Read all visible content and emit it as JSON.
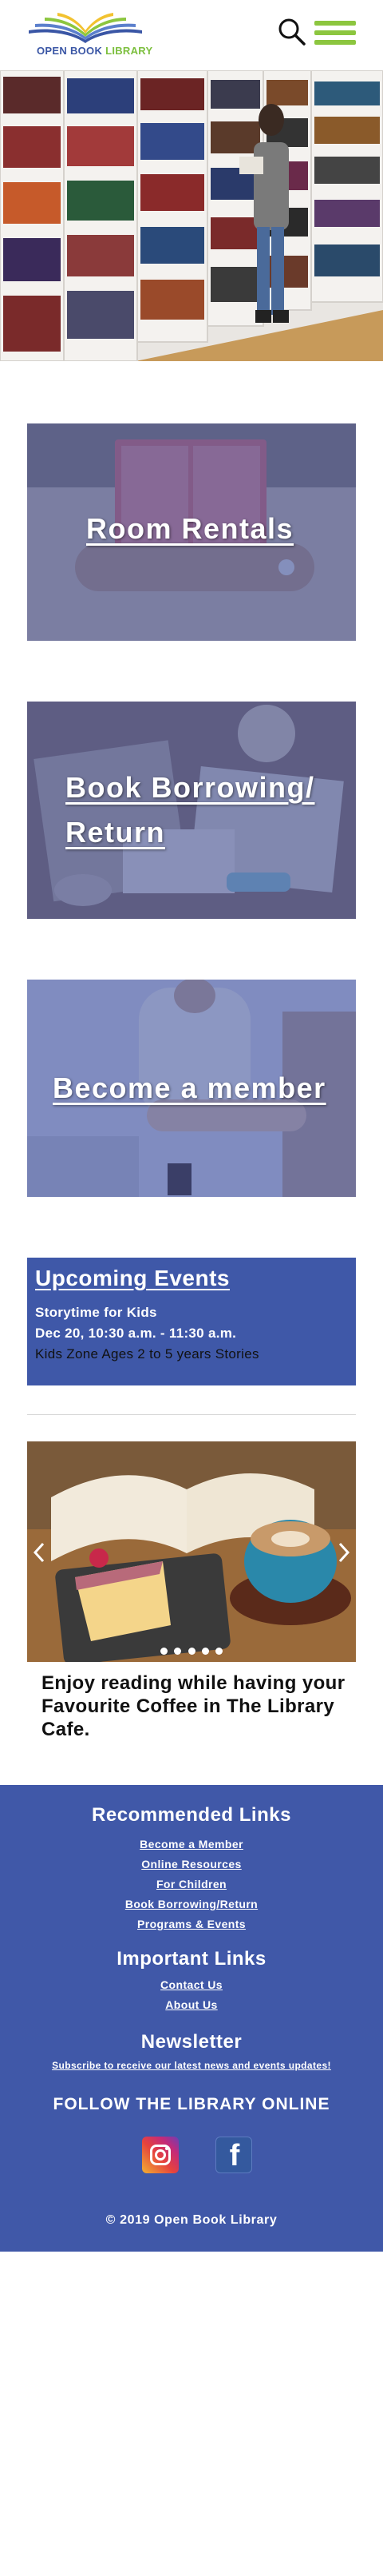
{
  "header": {
    "logo_line1": "OPEN BOOK",
    "logo_line2": "LIBRARY",
    "search_icon": "search-icon",
    "menu_icon": "hamburger-menu-icon"
  },
  "cards": [
    {
      "title": "Room Rentals"
    },
    {
      "title_line1": "Book Borrowing/",
      "title_line2": "Return"
    },
    {
      "title": "Become a member"
    }
  ],
  "events": {
    "title": "Upcoming Events",
    "name": "Storytime for Kids",
    "datetime": "Dec 20, 10:30 a.m. - 11:30 a.m.",
    "details": "Kids Zone Ages 2 to 5 years Stories"
  },
  "carousel": {
    "caption": "Enjoy reading while having your Favourite Coffee in The Library Cafe.",
    "slide_count": 5,
    "active_slide": 1
  },
  "footer": {
    "recommended_title": "Recommended Links",
    "recommended_links": [
      "Become a Member",
      "Online Resources",
      "For Children",
      "Book Borrowing/Return",
      "Programs & Events"
    ],
    "important_title": "Important Links",
    "important_links": [
      "Contact Us",
      "About Us"
    ],
    "newsletter_title": "Newsletter",
    "newsletter_link": "Subscribe to receive our latest news and events updates!",
    "follow_title": "FOLLOW THE LIBRARY ONLINE",
    "social": [
      "instagram-icon",
      "facebook-icon"
    ],
    "facebook_glyph": "f",
    "copyright": "© 2019 Open Book Library"
  },
  "colors": {
    "brand_blue": "#3f58a8",
    "brand_green": "#8cc63f"
  }
}
